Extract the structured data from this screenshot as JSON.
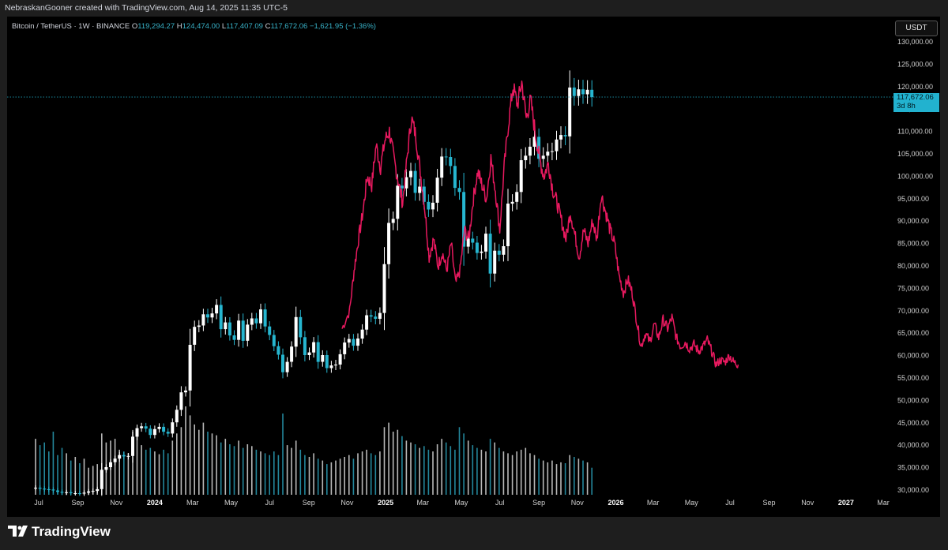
{
  "header": {
    "attribution": "NebraskanGooner created with TradingView.com, Aug 14, 2025 11:35 UTC-5"
  },
  "legend": {
    "symbol": "Bitcoin / TetherUS · 1W · BINANCE",
    "open_label": "O",
    "open": "119,294.27",
    "high_label": "H",
    "high": "124,474.00",
    "low_label": "L",
    "low": "117,407.09",
    "close_label": "C",
    "close": "117,672.06",
    "change": "−1,621.95 (−1.36%)"
  },
  "price_scale": {
    "currency": "USDT",
    "last_price": "117,672.06",
    "countdown": "3d 8h"
  },
  "footer": {
    "brand": "TradingView"
  },
  "colors": {
    "background": "#000000",
    "up_candle": "#ffffff",
    "down_candle": "#26b6d0",
    "projection": "#e8195f",
    "price_tag": "#22b2cf"
  },
  "chart_data": {
    "type": "candlestick",
    "title": "",
    "xlabel": "",
    "ylabel": "",
    "ylim": [
      29000,
      133000
    ],
    "grid": false,
    "y_ticks": [
      "30,000.00",
      "35,000.00",
      "40,000.00",
      "45,000.00",
      "50,000.00",
      "55,000.00",
      "60,000.00",
      "65,000.00",
      "70,000.00",
      "75,000.00",
      "80,000.00",
      "85,000.00",
      "90,000.00",
      "95,000.00",
      "100,000.00",
      "105,000.00",
      "110,000.00",
      "115,000.00",
      "120,000.00",
      "125,000.00",
      "130,000.00"
    ],
    "x_ticks": [
      "Jul",
      "Sep",
      "Nov",
      "2024",
      "Mar",
      "May",
      "Jul",
      "Sep",
      "Nov",
      "2025",
      "Mar",
      "May",
      "Jul",
      "Sep",
      "Nov",
      "2026",
      "Mar",
      "May",
      "Jul",
      "Sep",
      "Nov",
      "2027",
      "Mar"
    ],
    "x_bold_ticks": [
      "2024",
      "2025",
      "2026",
      "2027"
    ],
    "last_price": 117672.06,
    "weekly_closes": [
      30500,
      30300,
      30200,
      30100,
      29900,
      29600,
      29400,
      29500,
      29300,
      29300,
      29200,
      29400,
      29700,
      29800,
      30200,
      34500,
      35100,
      36200,
      37000,
      37800,
      37500,
      37600,
      41900,
      43800,
      44200,
      43700,
      42300,
      43600,
      44100,
      43000,
      42600,
      45100,
      47900,
      51800,
      52200,
      62400,
      66400,
      66700,
      69200,
      68500,
      69400,
      71300,
      65900,
      67400,
      64500,
      63500,
      67800,
      63300,
      66900,
      68300,
      67200,
      70300,
      66500,
      64600,
      62100,
      60200,
      56300,
      58600,
      62000,
      68600,
      64100,
      60100,
      60700,
      63000,
      58600,
      60100,
      57200,
      57800,
      58000,
      60300,
      62900,
      63700,
      62200,
      63800,
      65800,
      69000,
      68700,
      68200,
      69500,
      80400,
      89600,
      90500,
      97900,
      97300,
      99800,
      101200,
      96300,
      97700,
      94300,
      92600,
      94100,
      99700,
      104400,
      104300,
      102300,
      97400,
      96500,
      84300,
      86100,
      85200,
      82900,
      83200,
      87200,
      78300,
      83400,
      82500,
      84400,
      93900,
      94300,
      96500,
      103600,
      104600,
      106600,
      108800,
      103900,
      104600,
      105500,
      105600,
      108200,
      109200,
      108900,
      119800,
      117900,
      119400,
      118300,
      119300,
      117672
    ],
    "weekly_volume": [
      62000,
      55000,
      58000,
      48000,
      70000,
      44000,
      52000,
      46000,
      38000,
      42000,
      35000,
      40000,
      30000,
      32000,
      34000,
      68000,
      58000,
      60000,
      62000,
      50000,
      48000,
      46000,
      70000,
      72000,
      55000,
      50000,
      52000,
      48000,
      45000,
      50000,
      46000,
      60000,
      68000,
      75000,
      98000,
      88000,
      78000,
      72000,
      80000,
      70000,
      68000,
      66000,
      58000,
      62000,
      56000,
      54000,
      60000,
      52000,
      56000,
      54000,
      50000,
      48000,
      46000,
      44000,
      48000,
      44000,
      90000,
      55000,
      52000,
      60000,
      50000,
      44000,
      42000,
      46000,
      40000,
      38000,
      34000,
      36000,
      38000,
      40000,
      42000,
      44000,
      40000,
      46000,
      48000,
      50000,
      46000,
      44000,
      48000,
      75000,
      80000,
      70000,
      72000,
      65000,
      60000,
      58000,
      56000,
      52000,
      54000,
      50000,
      48000,
      56000,
      62000,
      58000,
      54000,
      50000,
      75000,
      68000,
      60000,
      55000,
      52000,
      50000,
      48000,
      62000,
      58000,
      52000,
      48000,
      46000,
      44000,
      48000,
      50000,
      52000,
      46000,
      44000,
      40000,
      38000,
      36000,
      38000,
      34000,
      36000,
      35000,
      44000,
      42000,
      40000,
      38000,
      36000,
      30000
    ],
    "projection": [
      {
        "x": "2024-10-24",
        "y": 66000
      },
      {
        "x": "2024-11-05",
        "y": 70000
      },
      {
        "x": "2024-11-12",
        "y": 79000
      },
      {
        "x": "2024-11-19",
        "y": 86000
      },
      {
        "x": "2024-11-26",
        "y": 92000
      },
      {
        "x": "2024-12-03",
        "y": 100000
      },
      {
        "x": "2024-12-10",
        "y": 98000
      },
      {
        "x": "2024-12-17",
        "y": 107000
      },
      {
        "x": "2024-12-24",
        "y": 102000
      },
      {
        "x": "2024-12-31",
        "y": 108000
      },
      {
        "x": "2025-01-07",
        "y": 110000
      },
      {
        "x": "2025-01-14",
        "y": 104000
      },
      {
        "x": "2025-01-21",
        "y": 99000
      },
      {
        "x": "2025-01-28",
        "y": 94000
      },
      {
        "x": "2025-02-04",
        "y": 104000
      },
      {
        "x": "2025-02-11",
        "y": 113000
      },
      {
        "x": "2025-02-18",
        "y": 109000
      },
      {
        "x": "2025-02-25",
        "y": 101000
      },
      {
        "x": "2025-03-04",
        "y": 93000
      },
      {
        "x": "2025-03-11",
        "y": 82000
      },
      {
        "x": "2025-03-18",
        "y": 86000
      },
      {
        "x": "2025-03-25",
        "y": 80000
      },
      {
        "x": "2025-04-01",
        "y": 83000
      },
      {
        "x": "2025-04-08",
        "y": 79000
      },
      {
        "x": "2025-04-15",
        "y": 85000
      },
      {
        "x": "2025-04-22",
        "y": 76000
      },
      {
        "x": "2025-04-29",
        "y": 79000
      },
      {
        "x": "2025-05-06",
        "y": 88000
      },
      {
        "x": "2025-05-13",
        "y": 86000
      },
      {
        "x": "2025-05-20",
        "y": 95000
      },
      {
        "x": "2025-05-27",
        "y": 101000
      },
      {
        "x": "2025-06-03",
        "y": 98000
      },
      {
        "x": "2025-06-10",
        "y": 95000
      },
      {
        "x": "2025-06-17",
        "y": 104000
      },
      {
        "x": "2025-06-24",
        "y": 97000
      },
      {
        "x": "2025-07-01",
        "y": 88000
      },
      {
        "x": "2025-07-08",
        "y": 102000
      },
      {
        "x": "2025-07-15",
        "y": 112000
      },
      {
        "x": "2025-07-22",
        "y": 120000
      },
      {
        "x": "2025-07-29",
        "y": 116000
      },
      {
        "x": "2025-08-05",
        "y": 121000
      },
      {
        "x": "2025-08-12",
        "y": 113000
      },
      {
        "x": "2025-08-19",
        "y": 117000
      },
      {
        "x": "2025-08-26",
        "y": 110000
      },
      {
        "x": "2025-09-02",
        "y": 104000
      },
      {
        "x": "2025-09-09",
        "y": 100000
      },
      {
        "x": "2025-09-16",
        "y": 103000
      },
      {
        "x": "2025-09-23",
        "y": 97000
      },
      {
        "x": "2025-09-30",
        "y": 94000
      },
      {
        "x": "2025-10-07",
        "y": 90000
      },
      {
        "x": "2025-10-14",
        "y": 86000
      },
      {
        "x": "2025-10-21",
        "y": 92000
      },
      {
        "x": "2025-10-28",
        "y": 87000
      },
      {
        "x": "2025-11-04",
        "y": 82000
      },
      {
        "x": "2025-11-11",
        "y": 88000
      },
      {
        "x": "2025-11-18",
        "y": 85000
      },
      {
        "x": "2025-11-25",
        "y": 90000
      },
      {
        "x": "2025-12-02",
        "y": 86000
      },
      {
        "x": "2025-12-09",
        "y": 96000
      },
      {
        "x": "2025-12-16",
        "y": 92000
      },
      {
        "x": "2025-12-23",
        "y": 88000
      },
      {
        "x": "2025-12-30",
        "y": 85000
      },
      {
        "x": "2026-01-06",
        "y": 78000
      },
      {
        "x": "2026-01-13",
        "y": 74000
      },
      {
        "x": "2026-01-20",
        "y": 77000
      },
      {
        "x": "2026-01-27",
        "y": 74000
      },
      {
        "x": "2026-02-03",
        "y": 68000
      },
      {
        "x": "2026-02-10",
        "y": 62000
      },
      {
        "x": "2026-02-17",
        "y": 65000
      },
      {
        "x": "2026-02-24",
        "y": 63000
      },
      {
        "x": "2026-03-03",
        "y": 67000
      },
      {
        "x": "2026-03-10",
        "y": 64000
      },
      {
        "x": "2026-03-17",
        "y": 68000
      },
      {
        "x": "2026-03-24",
        "y": 66000
      },
      {
        "x": "2026-03-31",
        "y": 68500
      },
      {
        "x": "2026-04-07",
        "y": 64000
      },
      {
        "x": "2026-04-14",
        "y": 62000
      },
      {
        "x": "2026-04-21",
        "y": 63000
      },
      {
        "x": "2026-04-28",
        "y": 61500
      },
      {
        "x": "2026-05-05",
        "y": 62500
      },
      {
        "x": "2026-05-12",
        "y": 61000
      },
      {
        "x": "2026-05-19",
        "y": 62000
      },
      {
        "x": "2026-05-26",
        "y": 63500
      },
      {
        "x": "2026-06-02",
        "y": 61000
      },
      {
        "x": "2026-06-09",
        "y": 58000
      },
      {
        "x": "2026-06-16",
        "y": 59000
      },
      {
        "x": "2026-06-23",
        "y": 58500
      },
      {
        "x": "2026-06-30",
        "y": 60000
      },
      {
        "x": "2026-07-07",
        "y": 58500
      },
      {
        "x": "2026-07-14",
        "y": 58000
      }
    ]
  }
}
